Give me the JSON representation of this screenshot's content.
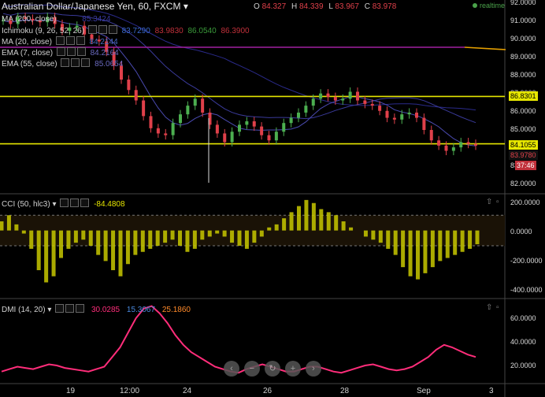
{
  "header": {
    "title": "Australian Dollar/Japanese Yen, 60, FXCM",
    "ohlc": [
      {
        "key": "O",
        "value": "84.327"
      },
      {
        "key": "H",
        "value": "84.339"
      },
      {
        "key": "L",
        "value": "83.967"
      },
      {
        "key": "C",
        "value": "83.978"
      }
    ],
    "realtime": "realtime"
  },
  "indicators": {
    "ma200": {
      "label": "MA (200, close)",
      "value": "85.3424"
    },
    "ichimoku": {
      "label": "Ichimoku (9, 26, 52, 26)",
      "v1": "83.7290",
      "v2": "83.9830",
      "v3": "86.0540",
      "v4": "86.3900"
    },
    "ma20": {
      "label": "MA (20, close)",
      "value": "84.2144"
    },
    "ema7": {
      "label": "EMA (7, close)",
      "value": "84.2164"
    },
    "ema55": {
      "label": "EMA (55, close)",
      "value": "85.0654"
    },
    "cci": {
      "label": "CCI (50, hlc3)",
      "value": "-84.4808"
    },
    "dmi": {
      "label": "DMI (14, 20)",
      "v1": "30.0285",
      "v2": "15.3067",
      "v3": "25.1860"
    }
  },
  "price_axis": [
    "92.0000",
    "91.0000",
    "90.0000",
    "89.0000",
    "88.0000",
    "87.0000",
    "86.0000",
    "85.0000",
    "84.0000",
    "83",
    "82.0000"
  ],
  "price_tags": {
    "level_high": "86.8301",
    "level_low": "84.1055",
    "last": "83.9780",
    "timer": "37:46"
  },
  "cci_axis": [
    "200.0000",
    "0.0000",
    "-200.0000",
    "-400.0000"
  ],
  "dmi_axis": [
    "60.0000",
    "40.0000",
    "20.0000"
  ],
  "time_axis": [
    "19",
    "12:00",
    "24",
    "26",
    "28",
    "Sep",
    "3"
  ],
  "colors": {
    "up": "#4caf50",
    "down": "#e0404a",
    "hline": "#e6e600",
    "purple": "#a020a0",
    "cci": "#c8c800",
    "dmi": "#ff2d7a",
    "ma": "#2a2a8a"
  },
  "nav": [
    "chevron-left-icon",
    "zoom-out-icon",
    "reset-icon",
    "zoom-in-icon",
    "chevron-right-icon"
  ],
  "chart_data": {
    "type": "line",
    "price_range": [
      81.5,
      92.2
    ],
    "horizontal_levels": [
      86.8301,
      84.1055
    ],
    "price": [
      91.2,
      91.0,
      91.4,
      91.3,
      91.2,
      91.1,
      91.4,
      91.0,
      90.6,
      90.8,
      90.9,
      90.4,
      90.1,
      90.0,
      89.4,
      88.6,
      87.8,
      87.2,
      86.6,
      85.7,
      85.0,
      84.7,
      84.6,
      85.3,
      85.8,
      86.3,
      86.7,
      85.9,
      85.2,
      84.7,
      84.2,
      84.8,
      85.2,
      85.4,
      85.1,
      84.6,
      84.3,
      84.8,
      85.3,
      85.6,
      85.9,
      86.3,
      86.7,
      87.0,
      86.8,
      86.6,
      86.7,
      87.1,
      86.6,
      86.4,
      86.3,
      86.0,
      85.6,
      85.5,
      85.8,
      85.9,
      85.6,
      84.9,
      84.3,
      84.0,
      83.7,
      83.9,
      84.2,
      84.1,
      84.0
    ],
    "cci_range": [
      -420,
      220
    ],
    "cci": [
      60,
      100,
      40,
      -20,
      -120,
      -260,
      -340,
      -300,
      -180,
      -120,
      -80,
      -60,
      -100,
      -160,
      -200,
      -260,
      -300,
      -220,
      -160,
      -140,
      -120,
      -100,
      -80,
      -60,
      -100,
      -140,
      -120,
      -60,
      -40,
      -20,
      -40,
      -80,
      -100,
      -120,
      -80,
      -40,
      20,
      40,
      80,
      120,
      160,
      200,
      180,
      140,
      120,
      100,
      60,
      20,
      0,
      -40,
      -60,
      -80,
      -120,
      -160,
      -240,
      -300,
      -320,
      -280,
      -240,
      -200,
      -180,
      -160,
      -140,
      -120,
      -90
    ],
    "dmi_range": [
      10,
      75
    ],
    "dmi": [
      18,
      20,
      22,
      21,
      20,
      22,
      24,
      23,
      21,
      20,
      19,
      18,
      20,
      22,
      30,
      38,
      50,
      62,
      70,
      72,
      66,
      58,
      48,
      40,
      34,
      30,
      26,
      22,
      20,
      18,
      17,
      20,
      22,
      24,
      22,
      20,
      18,
      18,
      20,
      22,
      22,
      20,
      18,
      17,
      19,
      21,
      23,
      24,
      22,
      20,
      19,
      20,
      22,
      26,
      30,
      36,
      40,
      38,
      35,
      32,
      30
    ]
  }
}
